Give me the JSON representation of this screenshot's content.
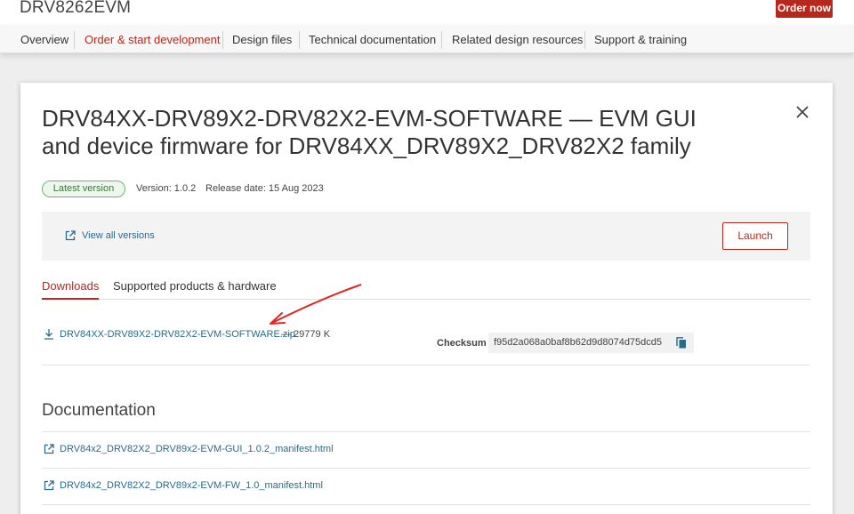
{
  "header": {
    "product_title": "DRV8262EVM",
    "order_button": "Order now"
  },
  "nav": {
    "items": [
      {
        "label": "Overview"
      },
      {
        "label": "Order & start development",
        "active": true
      },
      {
        "label": "Design files"
      },
      {
        "label": "Technical documentation"
      },
      {
        "label": "Related design resources"
      },
      {
        "label": "Support & training"
      }
    ]
  },
  "software": {
    "title_line1": "DRV84XX-DRV89X2-DRV82X2-EVM-SOFTWARE — EVM GUI",
    "title_line2": "and device firmware for DRV84XX_DRV89X2_DRV82X2 family",
    "badge": "Latest version",
    "version": "Version: 1.0.2",
    "release_date": "Release date: 15 Aug 2023",
    "view_versions": "View all versions",
    "launch_button": "Launch"
  },
  "tabs": {
    "downloads": "Downloads",
    "supported": "Supported products & hardware"
  },
  "download": {
    "file_name": "DRV84XX-DRV89X2-DRV82X2-EVM-SOFTWARE.zip",
    "size": "— 29779 K",
    "checksum_label": "Checksum",
    "checksum_value": "f95d2a068a0baf8b62d9d8074d75dcd5"
  },
  "documentation": {
    "heading": "Documentation",
    "items": [
      {
        "label": "DRV84x2_DRV82X2_DRV89x2-EVM-GUI_1.0.2_manifest.html"
      },
      {
        "label": "DRV84x2_DRV82X2_DRV89x2-EVM-FW_1.0_manifest.html"
      }
    ]
  },
  "colors": {
    "brand_red": "#b7271b",
    "link_blue": "#2a6a8a",
    "annotation_arrow": "#e0261e"
  }
}
